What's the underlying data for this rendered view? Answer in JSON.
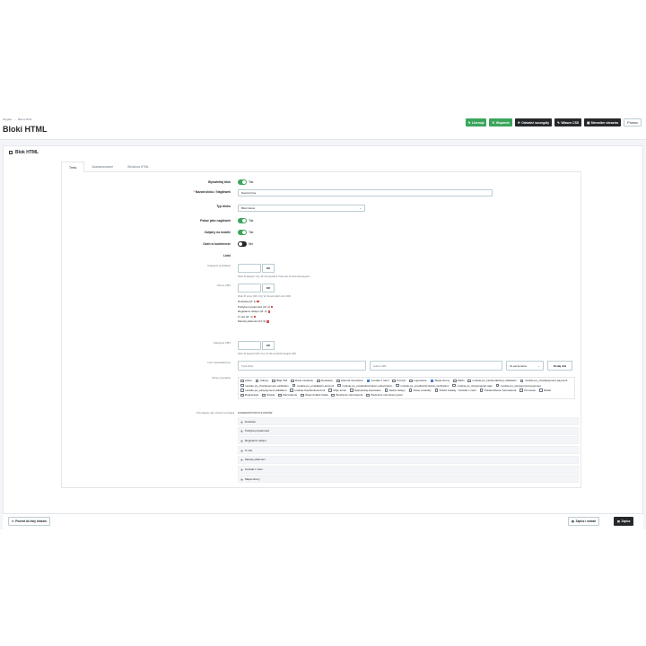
{
  "breadcrumb": [
    "Wygląd",
    "Bloki HTML"
  ],
  "page_title": "Bloki HTML",
  "toolbar": {
    "buttons": [
      {
        "label": "Licencja",
        "icon": "key-icon",
        "style": "green"
      },
      {
        "label": "Wsparcie",
        "icon": "refresh-icon",
        "style": "green"
      },
      {
        "label": "Odśwież szczegóły",
        "icon": "sync-icon",
        "style": "dark"
      },
      {
        "label": "Własne CSS",
        "icon": "edit-icon",
        "style": "dark"
      },
      {
        "label": "Menedżer obrazów",
        "icon": "image-icon",
        "style": "dark"
      },
      {
        "label": "Pomoc",
        "icon": "",
        "style": "light"
      }
    ]
  },
  "card_title": "Blok HTML",
  "tabs": [
    "Treść",
    "Zaawansowane",
    "Struktura HTML"
  ],
  "form": {
    "show_block": {
      "label": "Wyświetlaj blok",
      "value": "Tak"
    },
    "block_name": {
      "label": "Nazwa bloku / Nagłówek",
      "value": "Nasza firma",
      "required": "*"
    },
    "block_type": {
      "label": "Typ bloku",
      "value": "Blok linków"
    },
    "show_header": {
      "label": "Pokaż jako nagłówek",
      "value": "Tak"
    },
    "collapse_mobile": {
      "label": "Zwijany na mobile",
      "value": "Tak"
    },
    "in_container": {
      "label": "Owiń w kontenerze",
      "value": "Nie"
    },
    "links_title": "Linki",
    "product_categories": {
      "label": "Kategorie produktów",
      "button": "OK",
      "help": "Wpisz ID kategorii. Użyj \"all\" dla wszystkich. Puste pole oznacza brak kategorii."
    },
    "cms_pages": {
      "label": "Strony CMS",
      "button": "OK",
      "help": "Wpisz ID strony CMS. Użyj \"all\" dla wszystkich stron CMS.",
      "items": [
        "Dostawa (Id: 1)",
        "Polityka prywatności (Id: 2)",
        "Regulamin sklepu (Id: 3)",
        "O nas (Id: 4)",
        "Metody płatności (Id: 5)"
      ]
    },
    "cms_categories": {
      "label": "Kategorie CMS",
      "button": "OK",
      "help": "Wpisz ID kategorii CMS. Użyj \"all\" dla wszystkich kategorii CMS."
    },
    "custom_link": {
      "label": "Link niestandardowy",
      "placeholder_title": "Tytuł linku",
      "placeholder_url": "Adres URL",
      "window": "Ta sama karta",
      "button": "Dodaj link"
    },
    "special_pages": {
      "label": "Strony specjalne",
      "options": [
        {
          "label": "Adres",
          "checked": false
        },
        {
          "label": "Adresy",
          "checked": false
        },
        {
          "label": "Błąd 404",
          "checked": false
        },
        {
          "label": "Dane osobowe",
          "checked": false
        },
        {
          "label": "Dostawcy",
          "checked": false
        },
        {
          "label": "Historia zamówień",
          "checked": false
        },
        {
          "label": "Kontakt z nami",
          "checked": true
        },
        {
          "label": "Koszyk",
          "checked": false
        },
        {
          "label": "Logowanie",
          "checked": false
        },
        {
          "label": "Mapa strony",
          "checked": true
        },
        {
          "label": "Marki",
          "checked": false
        },
        {
          "label": "module-ps_cashondelivery-validation",
          "checked": false
        },
        {
          "label": "module-ps_checkpayment-payment",
          "checked": false
        },
        {
          "label": "module-ps_checkpayment-validation",
          "checked": false
        },
        {
          "label": "module-ps_emailalerts-account",
          "checked": false
        },
        {
          "label": "module-ps_emailsubscription-subscription",
          "checked": false
        },
        {
          "label": "module-ps_emailsubscription-verification",
          "checked": false
        },
        {
          "label": "module-ps_shoppingcart-ajax",
          "checked": false
        },
        {
          "label": "module-ps_wirepayment-payment",
          "checked": false
        },
        {
          "label": "module-ps_wirepayment-validation",
          "checked": false
        },
        {
          "label": "module-thecheckout-front",
          "checked": false
        },
        {
          "label": "Moje konto",
          "checked": false
        },
        {
          "label": "Najczęściej kupowane",
          "checked": false
        },
        {
          "label": "Nasze sklepy",
          "checked": false
        },
        {
          "label": "Nowe produkty",
          "checked": false
        },
        {
          "label": "Pokaż zasady - Kontakt z nami",
          "checked": false
        },
        {
          "label": "Potwierdzenie zamówienia",
          "checked": false
        },
        {
          "label": "Promocje",
          "checked": false
        },
        {
          "label": "Rabat",
          "checked": false
        },
        {
          "label": "Rejestracja",
          "checked": false
        },
        {
          "label": "Szukaj",
          "checked": false
        },
        {
          "label": "Zamówienie",
          "checked": false
        },
        {
          "label": "Zapomniałeś hasła",
          "checked": false
        },
        {
          "label": "Śledzenie zamówienia",
          "checked": false
        },
        {
          "label": "Śledzenie zamówień gości",
          "checked": false
        }
      ]
    },
    "reorder": {
      "label": "Przeciągnij, aby zmienić porządek",
      "title": "KOLEJNOŚĆ POZYCJI LINKÓW",
      "items": [
        "Dostawa",
        "Polityka prywatności",
        "Regulamin sklepu",
        "O nas",
        "Metody płatności",
        "Kontakt z nami",
        "Mapa strony"
      ]
    }
  },
  "footer": {
    "back": "Powrót do listy bloków",
    "save_stay": "Zapisz i zostań",
    "save": "Zapisz"
  },
  "colors": {
    "accent": "#3ba55c",
    "dark": "#25282b",
    "checked": "#3b7ed0"
  }
}
